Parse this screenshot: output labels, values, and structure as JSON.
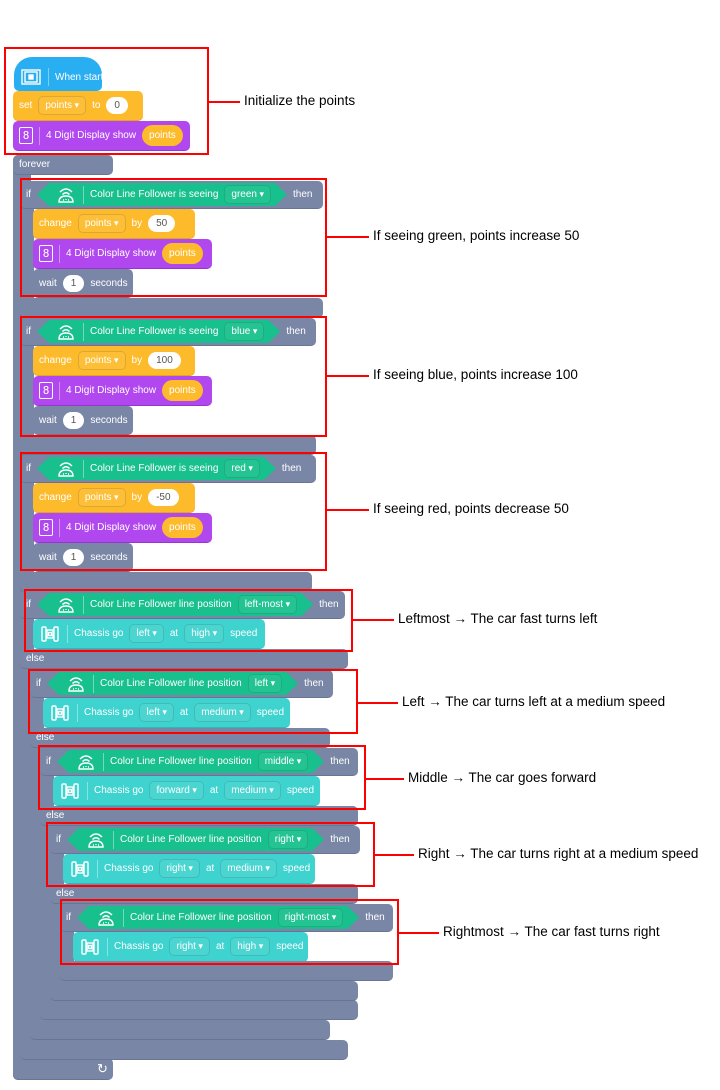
{
  "hat": {
    "label": "When start"
  },
  "set_block": {
    "label": "set",
    "variable": "points",
    "to": "to",
    "value": "0"
  },
  "display_init": {
    "label": "4 Digit Display show",
    "value": "points"
  },
  "forever": {
    "label": "forever"
  },
  "color_checks": [
    {
      "if": "if",
      "sensor": "Color Line Follower is seeing",
      "color": "green",
      "then": "then",
      "change": "change",
      "variable": "points",
      "by": "by",
      "amount": "50",
      "display": "4 Digit Display show",
      "display_value": "points",
      "wait": "wait",
      "wait_value": "1",
      "seconds": "seconds"
    },
    {
      "if": "if",
      "sensor": "Color Line Follower is seeing",
      "color": "blue",
      "then": "then",
      "change": "change",
      "variable": "points",
      "by": "by",
      "amount": "100",
      "display": "4 Digit Display show",
      "display_value": "points",
      "wait": "wait",
      "wait_value": "1",
      "seconds": "seconds"
    },
    {
      "if": "if",
      "sensor": "Color Line Follower is seeing",
      "color": "red",
      "then": "then",
      "change": "change",
      "variable": "points",
      "by": "by",
      "amount": "-50",
      "display": "4 Digit Display show",
      "display_value": "points",
      "wait": "wait",
      "wait_value": "1",
      "seconds": "seconds"
    }
  ],
  "line_checks": [
    {
      "if": "if",
      "sensor": "Color Line Follower line position",
      "position": "left-most",
      "then": "then",
      "chassis": "Chassis go",
      "direction": "left",
      "at": "at",
      "speed": "high",
      "speed_label": "speed",
      "else": "else"
    },
    {
      "if": "if",
      "sensor": "Color Line Follower line position",
      "position": "left",
      "then": "then",
      "chassis": "Chassis go",
      "direction": "left",
      "at": "at",
      "speed": "medium",
      "speed_label": "speed",
      "else": "else"
    },
    {
      "if": "if",
      "sensor": "Color Line Follower line position",
      "position": "middle",
      "then": "then",
      "chassis": "Chassis go",
      "direction": "forward",
      "at": "at",
      "speed": "medium",
      "speed_label": "speed",
      "else": "else"
    },
    {
      "if": "if",
      "sensor": "Color Line Follower line position",
      "position": "right",
      "then": "then",
      "chassis": "Chassis go",
      "direction": "right",
      "at": "at",
      "speed": "medium",
      "speed_label": "speed",
      "else": "else"
    },
    {
      "if": "if",
      "sensor": "Color Line Follower line position",
      "position": "right-most",
      "then": "then",
      "chassis": "Chassis go",
      "direction": "right",
      "at": "at",
      "speed": "high",
      "speed_label": "speed"
    }
  ],
  "annotations": [
    "Initialize the points",
    "If seeing green, points increase 50",
    "If seeing blue, points increase 100",
    "If seeing red, points decrease 50",
    "Leftmost → The car fast turns left",
    "Left → The car turns left at a medium speed",
    "Middle → The car goes forward",
    "Right → The car turns right at a medium speed",
    "Rightmost → The car fast turns right"
  ],
  "colors": {
    "event": "#29aef2",
    "variables": "#fdbb2c",
    "display": "#b148ef",
    "control": "#7a86a6",
    "sensor": "#17c08c",
    "chassis": "#3fd3cf",
    "annotation": "#ff0000"
  }
}
